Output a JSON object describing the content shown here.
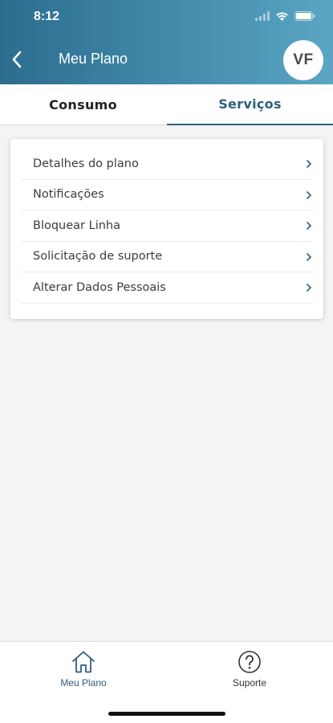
{
  "status_bar": {
    "time": "8:12",
    "icons": [
      "signal-icon",
      "wifi-icon",
      "battery-icon"
    ]
  },
  "nav": {
    "title": "Meu Plano",
    "avatar_initials": "VF",
    "back_icon": "chevron-left-icon"
  },
  "tabs": [
    {
      "label": "Consumo",
      "active": false
    },
    {
      "label": "Serviços",
      "active": true
    }
  ],
  "menu": {
    "items": [
      {
        "label": "Detalhes do plano"
      },
      {
        "label": "Notificações"
      },
      {
        "label": "Bloquear Linha"
      },
      {
        "label": "Solicitação de suporte"
      },
      {
        "label": "Alterar Dados Pessoais"
      }
    ],
    "item_icon": "chevron-right-icon"
  },
  "bottom_nav": {
    "items": [
      {
        "label": "Meu Plano",
        "icon": "home-icon",
        "active": true
      },
      {
        "label": "Suporte",
        "icon": "help-circle-icon",
        "active": false
      }
    ]
  },
  "colors": {
    "header_gradient_start": "#2c6d8e",
    "header_gradient_end": "#5aa6c4",
    "accent": "#2d5f7c",
    "background": "#f4f4f4"
  }
}
